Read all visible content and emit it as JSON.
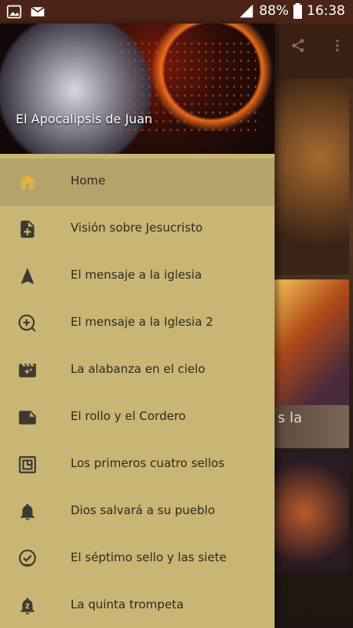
{
  "status_bar": {
    "battery": "88%",
    "time": "16:38"
  },
  "app": {
    "bg_card_text": "s la"
  },
  "drawer": {
    "title": "El Apocalipsis de Juan",
    "items": [
      {
        "label": "Home",
        "icon": "home-icon",
        "active": true
      },
      {
        "label": "Visión sobre Jesucristo",
        "icon": "note-add-icon"
      },
      {
        "label": "El mensaje a la iglesia",
        "icon": "navigation-arrow-icon"
      },
      {
        "label": "El mensaje a la Iglesia 2",
        "icon": "add-circle-icon"
      },
      {
        "label": "La alabanza en el cielo",
        "icon": "movie-filter-icon"
      },
      {
        "label": "El rollo y el Cordero",
        "icon": "note-icon"
      },
      {
        "label": "Los primeros cuatro sellos",
        "icon": "account-box-icon"
      },
      {
        "label": "Dios salvará a su pueblo",
        "icon": "bell-icon"
      },
      {
        "label": "El séptimo sello y las siete",
        "icon": "check-circle-icon"
      },
      {
        "label": "La quinta trompeta",
        "icon": "snooze-bell-icon"
      }
    ]
  },
  "colors": {
    "drawer_bg": "#c9b674",
    "active_item_bg": "#b5a36a",
    "icon_color": "#3d3a32",
    "status_bar": "#4a2416"
  }
}
